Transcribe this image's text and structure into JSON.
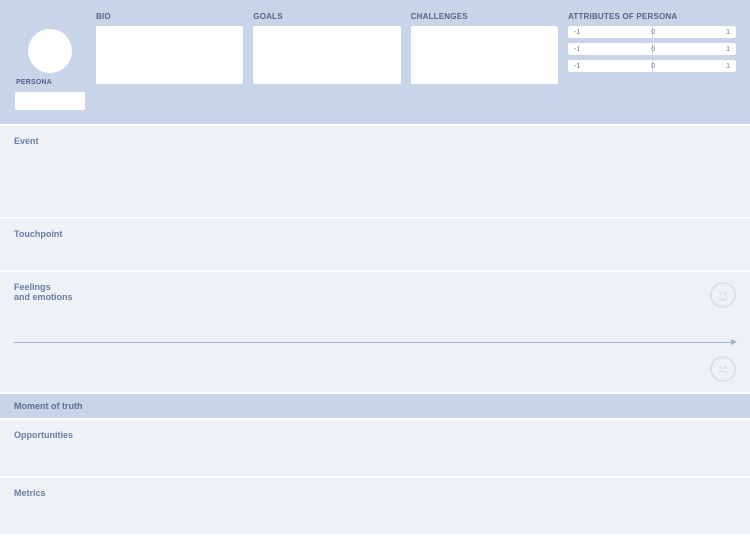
{
  "header": {
    "persona_label": "PERSONA",
    "bio_label": "BIO",
    "goals_label": "GOALS",
    "challenges_label": "CHALLENGES",
    "attributes_label": "ATTRIBUTES OF PERSONA",
    "slider": {
      "min": "-1",
      "mid": "0",
      "max": "1"
    }
  },
  "rows": {
    "event": "Event",
    "touchpoint": "Touchpoint",
    "feelings": "Feelings\nand emotions",
    "moment_of_truth": "Moment of truth",
    "opportunities": "Opportunities",
    "metrics": "Metrics"
  }
}
